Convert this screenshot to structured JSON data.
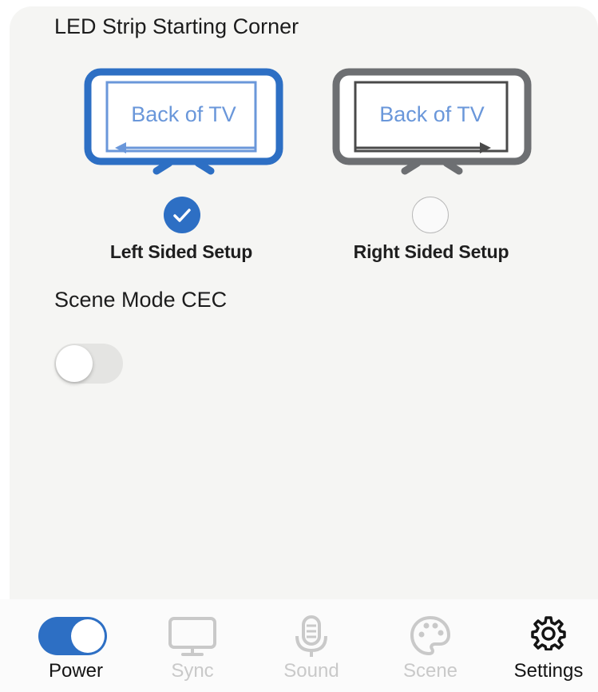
{
  "led_section": {
    "title": "LED Strip Starting Corner",
    "left_option": {
      "tv_text": "Back of TV",
      "label": "Left Sided Setup",
      "selected": true
    },
    "right_option": {
      "tv_text": "Back of TV",
      "label": "Right Sided Setup",
      "selected": false
    }
  },
  "cec_section": {
    "title": "Scene Mode CEC",
    "enabled": false
  },
  "tabbar": {
    "power": {
      "label": "Power",
      "switch_on": true
    },
    "sync": {
      "label": "Sync",
      "icon": "monitor-icon"
    },
    "sound": {
      "label": "Sound",
      "icon": "microphone-icon"
    },
    "scene": {
      "label": "Scene",
      "icon": "palette-icon"
    },
    "settings": {
      "label": "Settings",
      "icon": "gear-icon"
    }
  },
  "colors": {
    "accent": "#2d6fc4",
    "accent_light": "#6a97da",
    "gray_frame": "#6d6f72",
    "inactive_tab": "#c9c9c9"
  }
}
